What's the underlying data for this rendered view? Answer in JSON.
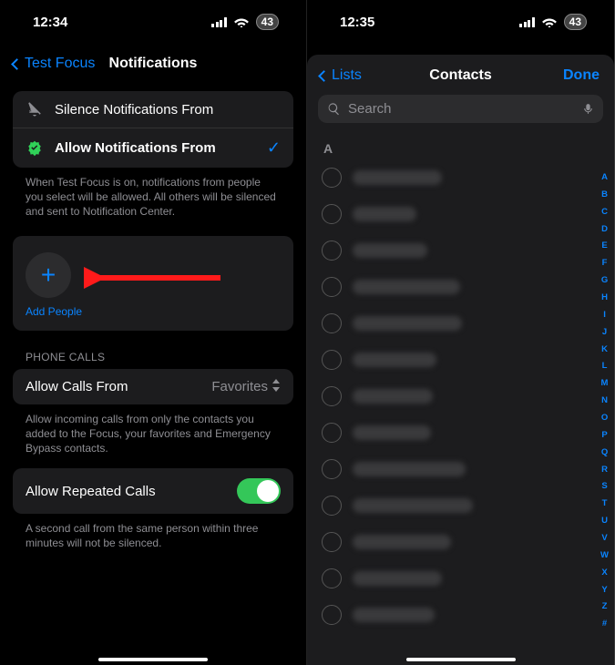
{
  "left": {
    "status": {
      "time": "12:34",
      "battery": "43"
    },
    "nav": {
      "back": "Test Focus",
      "title": "Notifications"
    },
    "modeCard": {
      "silence": "Silence Notifications From",
      "allow": "Allow Notifications From"
    },
    "modeDesc": "When Test Focus is on, notifications from people you select will be allowed. All others will be silenced and sent to Notification Center.",
    "addPeople": "Add People",
    "phoneCallsHeader": "PHONE CALLS",
    "allowCalls": {
      "label": "Allow Calls From",
      "value": "Favorites"
    },
    "allowCallsDesc": "Allow incoming calls from only the contacts you added to the Focus, your favorites and Emergency Bypass contacts.",
    "repeatedCalls": {
      "label": "Allow Repeated Calls",
      "on": true
    },
    "repeatedDesc": "A second call from the same person within three minutes will not be silenced."
  },
  "right": {
    "status": {
      "time": "12:35",
      "battery": "43"
    },
    "sheet": {
      "back": "Lists",
      "title": "Contacts",
      "done": "Done",
      "searchPlaceholder": "Search",
      "section": "A",
      "contactWidths": [
        98,
        70,
        82,
        118,
        120,
        92,
        88,
        86,
        124,
        132,
        108,
        98,
        90
      ],
      "index": [
        "A",
        "B",
        "C",
        "D",
        "E",
        "F",
        "G",
        "H",
        "I",
        "J",
        "K",
        "L",
        "M",
        "N",
        "O",
        "P",
        "Q",
        "R",
        "S",
        "T",
        "U",
        "V",
        "W",
        "X",
        "Y",
        "Z",
        "#"
      ]
    }
  }
}
